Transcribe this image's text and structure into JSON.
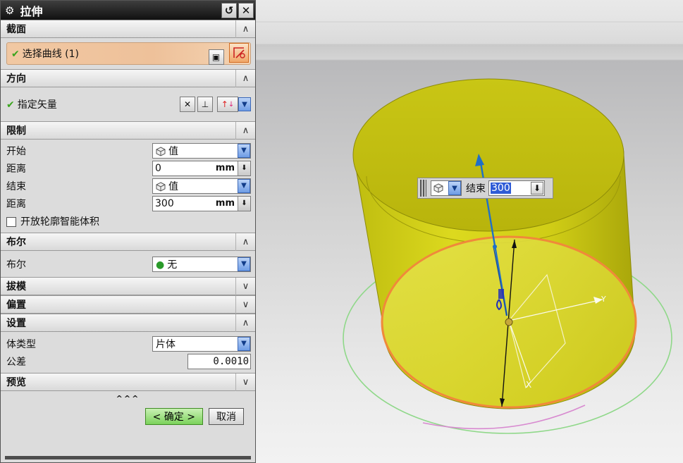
{
  "dialog": {
    "title": "拉伸",
    "sections": {
      "section": {
        "label": "截面",
        "select_curve_label": "选择曲线 (1)"
      },
      "direction": {
        "label": "方向",
        "specify_vector_label": "指定矢量"
      },
      "limits": {
        "label": "限制",
        "start_label": "开始",
        "start_value": "值",
        "start_distance_label": "距离",
        "start_distance_value": "0",
        "start_distance_unit": "mm",
        "end_label": "结束",
        "end_value": "值",
        "end_distance_label": "距离",
        "end_distance_value": "300",
        "end_distance_unit": "mm",
        "open_profile_label": "开放轮廓智能体积"
      },
      "boolean": {
        "label": "布尔",
        "field_label": "布尔",
        "value": "无"
      },
      "draft": {
        "label": "拔模"
      },
      "offset": {
        "label": "偏置"
      },
      "settings": {
        "label": "设置",
        "body_type_label": "体类型",
        "body_type_value": "片体",
        "tolerance_label": "公差",
        "tolerance_value": "0.0010"
      },
      "preview": {
        "label": "预览"
      }
    },
    "more_label": "^^^",
    "ok_label": "< 确定 >",
    "cancel_label": "取消"
  },
  "canvas_input": {
    "label": "结束",
    "value": "300"
  },
  "axes": {
    "x_label": "X",
    "y_label": "Y"
  },
  "icons": [
    "gear-icon",
    "reset-icon",
    "close-icon",
    "collapse-icon",
    "expand-icon",
    "curve-select-icon",
    "section-sketch-icon",
    "vector-icon",
    "cube-icon",
    "boolean-none-icon",
    "dropdown-arrow-icon",
    "spin-down-icon"
  ],
  "colors": {
    "solid": "#d6d21a",
    "edge": "#f0893a",
    "vector": "#1f6fc8",
    "titlebar": "#222222",
    "ok_button": "#7bd25b"
  }
}
